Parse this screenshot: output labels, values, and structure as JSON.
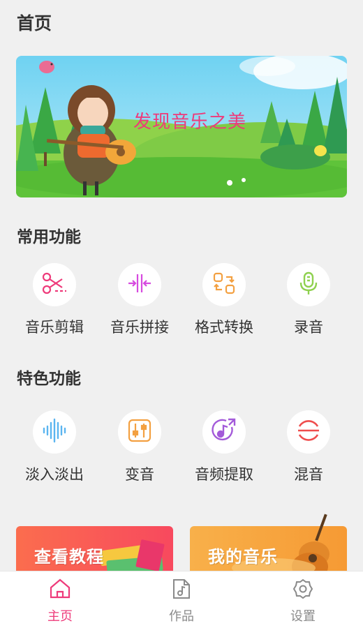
{
  "header": {
    "title": "首页"
  },
  "banner": {
    "slogan": "发现音乐之美"
  },
  "common": {
    "title": "常用功能",
    "items": [
      {
        "label": "音乐剪辑",
        "icon": "scissors-icon"
      },
      {
        "label": "音乐拼接",
        "icon": "merge-icon"
      },
      {
        "label": "格式转换",
        "icon": "convert-icon"
      },
      {
        "label": "录音",
        "icon": "microphone-icon"
      }
    ]
  },
  "featured": {
    "title": "特色功能",
    "items": [
      {
        "label": "淡入淡出",
        "icon": "waveform-icon"
      },
      {
        "label": "变音",
        "icon": "equalizer-icon"
      },
      {
        "label": "音频提取",
        "icon": "music-extract-icon"
      },
      {
        "label": "混音",
        "icon": "mix-icon"
      }
    ]
  },
  "cards": {
    "tutorial": "查看教程",
    "my_music": "我的音乐"
  },
  "tabbar": {
    "items": [
      {
        "label": "主页",
        "icon": "home-icon",
        "active": true
      },
      {
        "label": "作品",
        "icon": "music-file-icon",
        "active": false
      },
      {
        "label": "设置",
        "icon": "gear-icon",
        "active": false
      }
    ]
  },
  "colors": {
    "accent": "#ee3a7a",
    "inactive": "#8a8a8a",
    "background": "#f0f0f0"
  }
}
